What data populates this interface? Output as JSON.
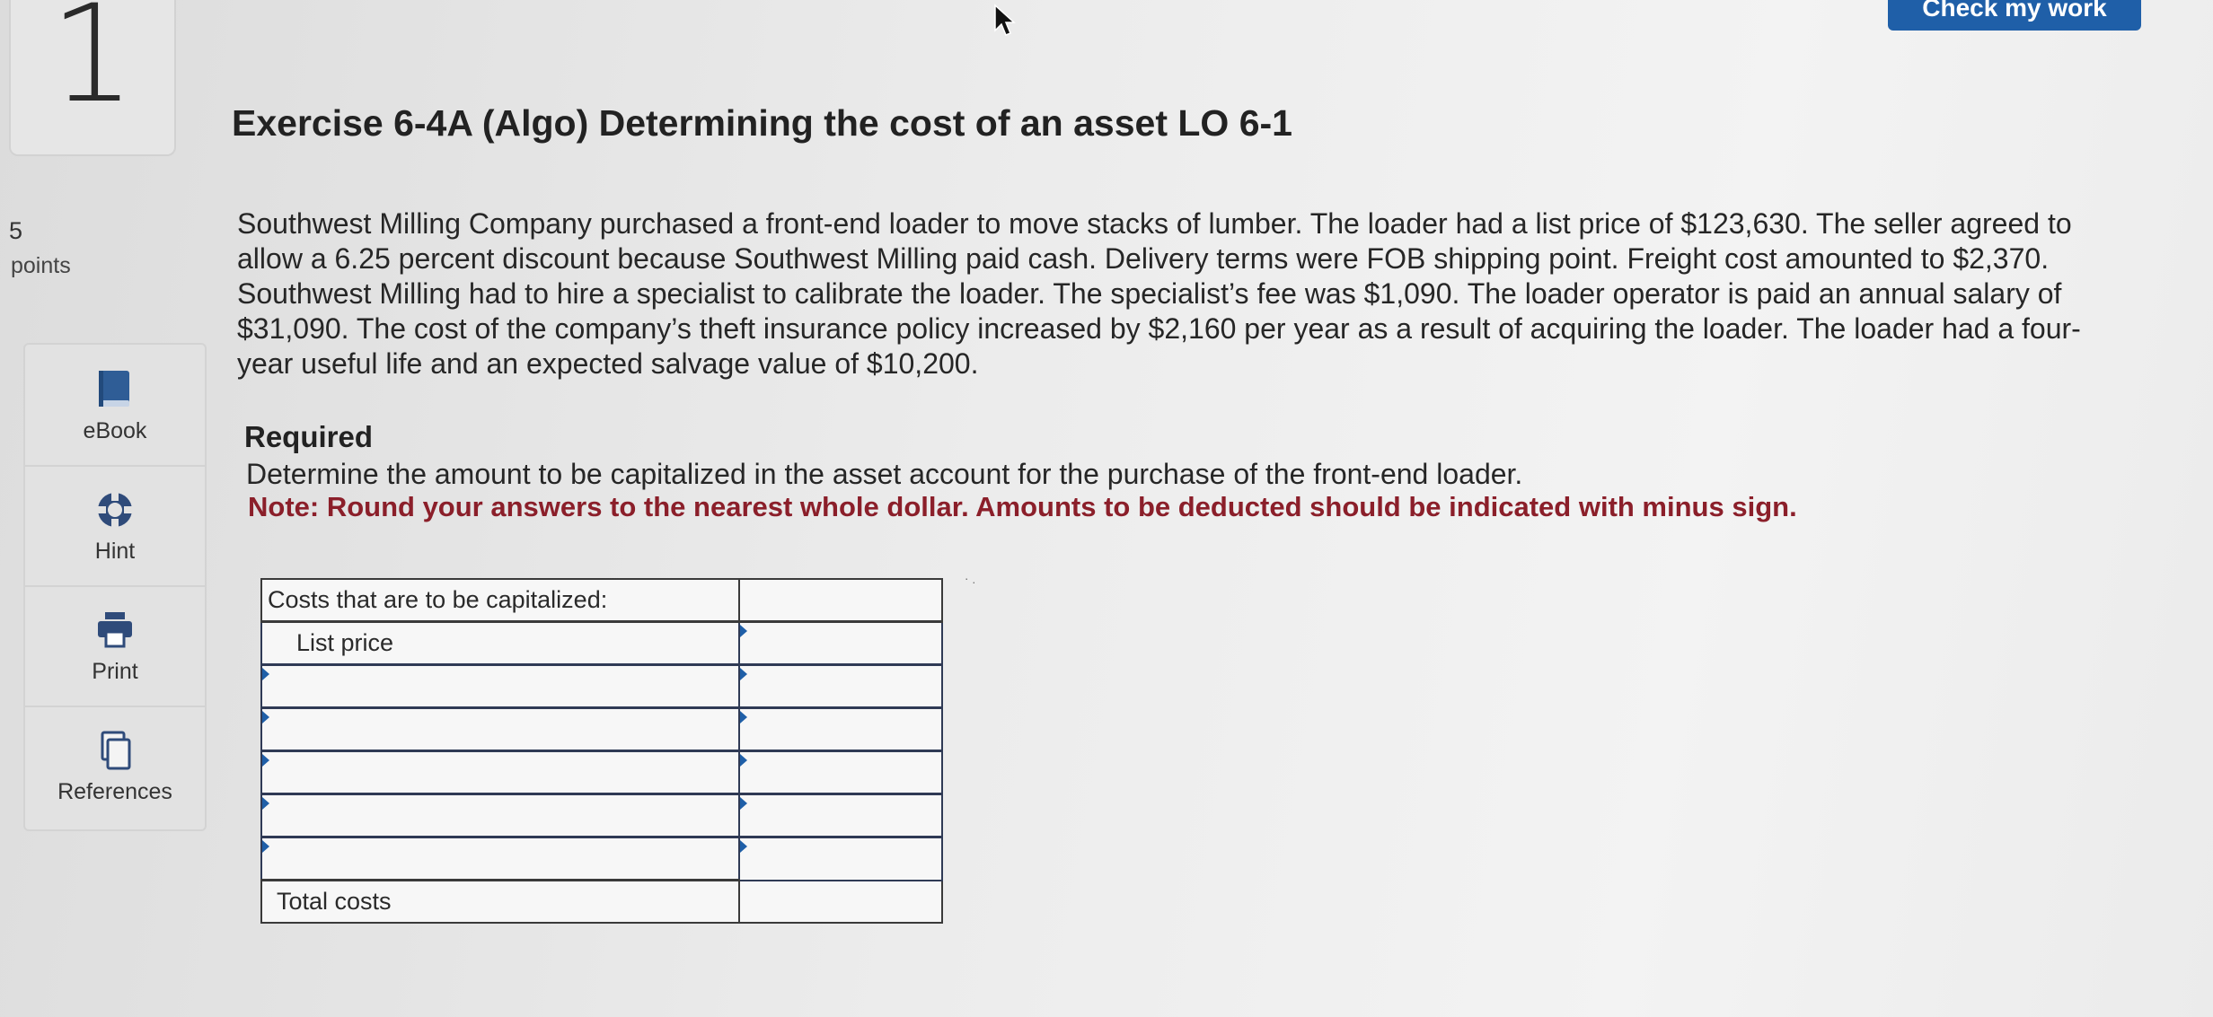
{
  "question": {
    "number": "1",
    "points_value": "5",
    "points_label": "points"
  },
  "tools": [
    {
      "label": "eBook",
      "icon": "ebook-icon"
    },
    {
      "label": "Hint",
      "icon": "lifebuoy-icon"
    },
    {
      "label": "Print",
      "icon": "printer-icon"
    },
    {
      "label": "References",
      "icon": "copy-icon"
    }
  ],
  "header": {
    "check_button_label": "Check my work"
  },
  "exercise": {
    "title": "Exercise 6-4A (Algo) Determining the cost of an asset LO 6-1",
    "problem_text": "Southwest Milling Company purchased a front-end loader to move stacks of lumber. The loader had a list price of $123,630. The seller agreed to allow a 6.25 percent discount because Southwest Milling paid cash. Delivery terms were FOB shipping point. Freight cost amounted to $2,370. Southwest Milling had to hire a specialist to calibrate the loader. The specialist’s fee was $1,090. The loader operator is paid an annual salary of $31,090. The cost of the company’s theft insurance policy increased by $2,160 per year as a result of acquiring the loader. The loader had a four-year useful life and an expected salvage value of $10,200.",
    "required_heading": "Required",
    "required_text": "Determine the amount to be capitalized in the asset account for the purchase of the front-end loader.",
    "note_text": "Note: Round your answers to the nearest whole dollar. Amounts to be deducted should be indicated with minus sign."
  },
  "cost_table": {
    "header": "Costs that are to be capitalized:",
    "first_row_label": "List price",
    "first_row_value": "",
    "blank_rows": [
      {
        "label": "",
        "value": ""
      },
      {
        "label": "",
        "value": ""
      },
      {
        "label": "",
        "value": ""
      },
      {
        "label": "",
        "value": ""
      },
      {
        "label": "",
        "value": ""
      }
    ],
    "total_label": "Total costs",
    "total_value": ""
  },
  "colors": {
    "accent": "#1f5fa8",
    "note": "#8b1f2a"
  }
}
